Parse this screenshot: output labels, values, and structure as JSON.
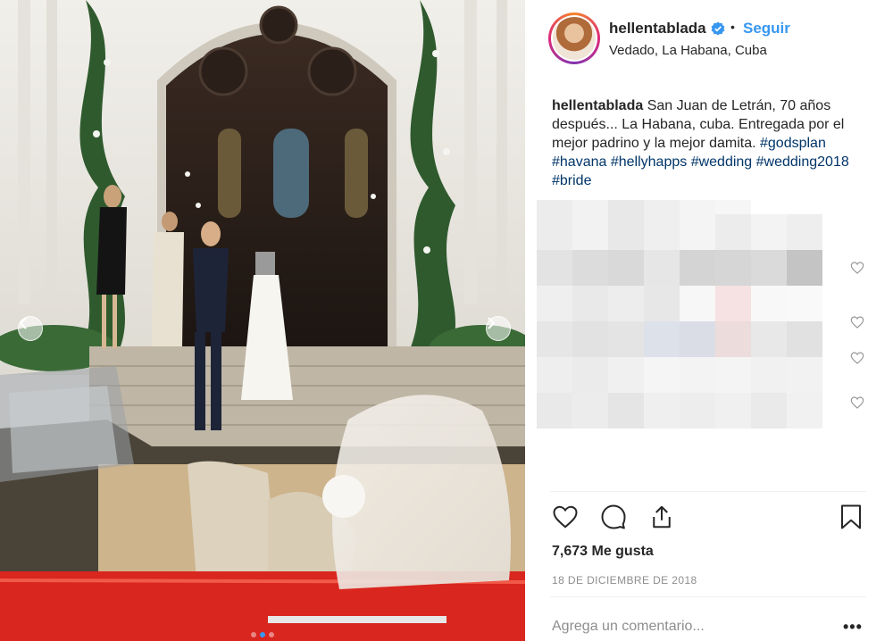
{
  "post": {
    "username": "hellentablada",
    "follow_label": "Seguir",
    "separator": "•",
    "location": "Vedado, La Habana, Cuba",
    "caption": {
      "username": "hellentablada",
      "text": " San Juan de Letrán, 70 años después... La Habana, cuba. Entregada por el mejor padrino y la mejor damita.",
      "hashtags": [
        "#godsplan",
        "#havana",
        "#hellyhapps",
        "#wedding",
        "#wedding2018",
        "#bride"
      ]
    },
    "likes": "7,673 Me gusta",
    "date": "18 DE DICIEMBRE DE 2018",
    "comment_placeholder": "Agrega un comentario...",
    "more_options": "•••"
  },
  "carousel": {
    "total": 3,
    "active_index": 1
  },
  "icons": {
    "verified": "verified-badge-icon",
    "like": "heart-icon",
    "comment": "comment-icon",
    "share": "share-icon",
    "save": "bookmark-icon",
    "prev": "chevron-left-icon",
    "next": "chevron-right-icon"
  },
  "colors": {
    "link": "#3897f0",
    "hashtag": "#003569",
    "text": "#262626",
    "muted": "#8e8e8e",
    "car_red": "#d9261f"
  }
}
